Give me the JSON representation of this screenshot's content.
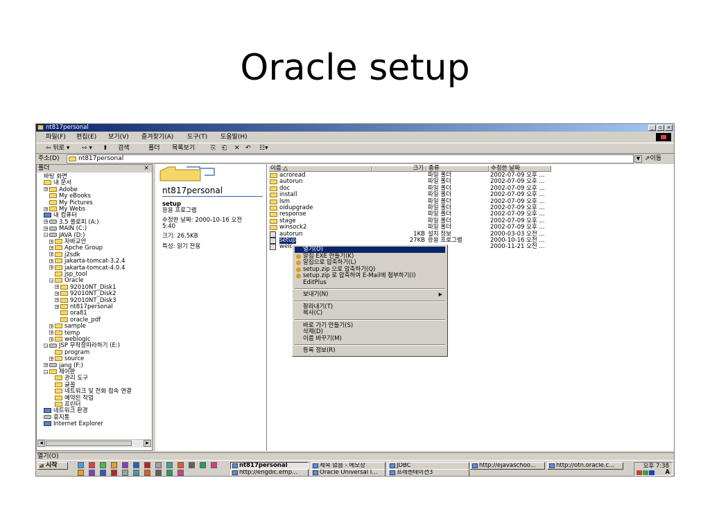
{
  "slide": {
    "title": "Oracle setup"
  },
  "window": {
    "title": "nt817personal",
    "min": "_",
    "max": "▫",
    "close": "×"
  },
  "menubar": [
    "파일(F)",
    "편집(E)",
    "보기(V)",
    "즐겨찾기(A)",
    "도구(T)",
    "도움말(H)"
  ],
  "toolbar": {
    "back": "⇦ 뒤로 ▾",
    "forward": "⇨ ▾",
    "up": "⬆",
    "search": "검색",
    "folders": "폴더",
    "history": "목록보기",
    "move": "⎘",
    "copy": "⎗",
    "delete": "✕",
    "undo": "↶",
    "views": "☷▾"
  },
  "address": {
    "label": "주소(D)",
    "value": "nt817personal",
    "dropdown": "▼",
    "go": "⇗이동"
  },
  "tree": {
    "header": "폴더",
    "close": "×",
    "items": [
      {
        "label": "바탕 화면",
        "lvl": 0,
        "ex": "",
        "icon": ""
      },
      {
        "label": "내 문서",
        "lvl": 0,
        "ex": "",
        "icon": "fd"
      },
      {
        "label": "Adobe",
        "lvl": 1,
        "ex": "+",
        "icon": "fd"
      },
      {
        "label": "My eBooks",
        "lvl": 1,
        "ex": "",
        "icon": "fd"
      },
      {
        "label": "My Pictures",
        "lvl": 1,
        "ex": "",
        "icon": "fd"
      },
      {
        "label": "My Webs",
        "lvl": 1,
        "ex": "+",
        "icon": "fd"
      },
      {
        "label": "내 컴퓨터",
        "lvl": 0,
        "ex": "",
        "icon": "pc"
      },
      {
        "label": "3.5 플로피 (A:)",
        "lvl": 1,
        "ex": "+",
        "icon": "dv"
      },
      {
        "label": "MAIN (C:)",
        "lvl": 1,
        "ex": "+",
        "icon": "dv"
      },
      {
        "label": "JAVA (D:)",
        "lvl": 1,
        "ex": "−",
        "icon": "dv"
      },
      {
        "label": "자바교안",
        "lvl": 2,
        "ex": "+",
        "icon": "fd"
      },
      {
        "label": "Apche Group",
        "lvl": 2,
        "ex": "+",
        "icon": "fd"
      },
      {
        "label": "j2sdk",
        "lvl": 2,
        "ex": "+",
        "icon": "fd"
      },
      {
        "label": "jakarta-tomcat-3.2.4",
        "lvl": 2,
        "ex": "+",
        "icon": "fd"
      },
      {
        "label": "jakarta-tomcat-4.0.4",
        "lvl": 2,
        "ex": "+",
        "icon": "fd"
      },
      {
        "label": "jsp_tool",
        "lvl": 2,
        "ex": "",
        "icon": "fd"
      },
      {
        "label": "Oracle",
        "lvl": 2,
        "ex": "−",
        "icon": "fd"
      },
      {
        "label": "92010NT_Disk1",
        "lvl": 3,
        "ex": "+",
        "icon": "fd"
      },
      {
        "label": "92010NT_Disk2",
        "lvl": 3,
        "ex": "+",
        "icon": "fd"
      },
      {
        "label": "92010NT_Disk3",
        "lvl": 3,
        "ex": "+",
        "icon": "fd"
      },
      {
        "label": "nt817personal",
        "lvl": 3,
        "ex": "+",
        "icon": "fd"
      },
      {
        "label": "ora81",
        "lvl": 3,
        "ex": "",
        "icon": "fd"
      },
      {
        "label": "oracle_pdf",
        "lvl": 3,
        "ex": "",
        "icon": "fd"
      },
      {
        "label": "sample",
        "lvl": 2,
        "ex": "+",
        "icon": "fd"
      },
      {
        "label": "temp",
        "lvl": 2,
        "ex": "+",
        "icon": "fd"
      },
      {
        "label": "weblogic",
        "lvl": 2,
        "ex": "+",
        "icon": "fd"
      },
      {
        "label": "JSP 무작정따라하기 (E:)",
        "lvl": 1,
        "ex": "−",
        "icon": "dv"
      },
      {
        "label": "program",
        "lvl": 2,
        "ex": "",
        "icon": "fd"
      },
      {
        "label": "source",
        "lvl": 2,
        "ex": "+",
        "icon": "fd"
      },
      {
        "label": "jang (F:)",
        "lvl": 1,
        "ex": "+",
        "icon": "dv"
      },
      {
        "label": "제어판",
        "lvl": 1,
        "ex": "−",
        "icon": "fd"
      },
      {
        "label": "관리 도구",
        "lvl": 2,
        "ex": "",
        "icon": "fd"
      },
      {
        "label": "글꼴",
        "lvl": 2,
        "ex": "",
        "icon": "fd"
      },
      {
        "label": "네트워크 및 전화 접속 연결",
        "lvl": 2,
        "ex": "",
        "icon": "fd"
      },
      {
        "label": "예약된 작업",
        "lvl": 2,
        "ex": "",
        "icon": "fd"
      },
      {
        "label": "프린터",
        "lvl": 2,
        "ex": "",
        "icon": "fd"
      },
      {
        "label": "네트워크 환경",
        "lvl": 0,
        "ex": "",
        "icon": "pc"
      },
      {
        "label": "휴지통",
        "lvl": 0,
        "ex": "",
        "icon": "dv"
      },
      {
        "label": "Internet Explorer",
        "lvl": 0,
        "ex": "",
        "icon": "pc"
      }
    ]
  },
  "info": {
    "folder_title": "nt817personal",
    "item_name": "setup",
    "item_type": "응용 프로그램",
    "modified_line1": "수정한 날짜: 2000-10-16 오전",
    "modified_line2": "5:40",
    "size": "크기: 26.5KB",
    "attributes": "특성: 읽기 전용"
  },
  "list": {
    "headers": {
      "name": "이름",
      "size": "크기",
      "type": "종류",
      "modified": "수정한 날짜"
    },
    "rows": [
      {
        "name": "acroread",
        "size": "",
        "type": "파일 폴더",
        "modified": "2002-07-09 오후 ...",
        "icon": "fd"
      },
      {
        "name": "autorun",
        "size": "",
        "type": "파일 폴더",
        "modified": "2002-07-09 오후 ...",
        "icon": "fd"
      },
      {
        "name": "doc",
        "size": "",
        "type": "파일 폴더",
        "modified": "2002-07-09 오후 ...",
        "icon": "fd"
      },
      {
        "name": "install",
        "size": "",
        "type": "파일 폴더",
        "modified": "2002-07-09 오후 ...",
        "icon": "fd"
      },
      {
        "name": "lsm",
        "size": "",
        "type": "파일 폴더",
        "modified": "2002-07-09 오후 ...",
        "icon": "fd"
      },
      {
        "name": "oidupgrade",
        "size": "",
        "type": "파일 폴더",
        "modified": "2002-07-09 오후 ...",
        "icon": "fd"
      },
      {
        "name": "response",
        "size": "",
        "type": "파일 폴더",
        "modified": "2002-07-09 오후 ...",
        "icon": "fd"
      },
      {
        "name": "stage",
        "size": "",
        "type": "파일 폴더",
        "modified": "2002-07-09 오후 ...",
        "icon": "fd"
      },
      {
        "name": "winsock2",
        "size": "",
        "type": "파일 폴더",
        "modified": "2002-07-09 오후 ...",
        "icon": "fd"
      },
      {
        "name": "autorun",
        "size": "1KB",
        "type": "설치 정보",
        "modified": "2000-03-03 오전 ...",
        "icon": "ic"
      },
      {
        "name": "setup",
        "size": "27KB",
        "type": "응용 프로그램",
        "modified": "2000-10-16 오전 ...",
        "icon": "ic",
        "selected": true
      },
      {
        "name": "welc",
        "size": "",
        "type": "",
        "modified": "2000-11-21 오전 ...",
        "icon": "ic"
      }
    ]
  },
  "context_menu": {
    "items": [
      {
        "label": "열기(O)",
        "highlight": true
      },
      {
        "label": "알집 EXE 만들기(K)",
        "icon": true
      },
      {
        "label": "알집으로 압축하기(L)",
        "icon": true
      },
      {
        "label": "setup.zip 으로 압축하기(Q)",
        "icon": true
      },
      {
        "label": "setup.zip 로 압축하여 E-Mail에 첨부하기(I)",
        "icon": true
      },
      {
        "label": "EditPlus"
      },
      {
        "sep": true
      },
      {
        "label": "보내기(N)",
        "arrow": "▶"
      },
      {
        "sep": true
      },
      {
        "label": "잘라내기(T)"
      },
      {
        "label": "복사(C)"
      },
      {
        "sep": true
      },
      {
        "label": "바로 가기 만들기(S)"
      },
      {
        "label": "삭제(D)"
      },
      {
        "label": "이름 바꾸기(M)"
      },
      {
        "sep": true
      },
      {
        "label": "등록 정보(R)"
      }
    ]
  },
  "statusbar": {
    "text": "열기(O)"
  },
  "taskbar": {
    "start": "시작",
    "buttons_row1": [
      {
        "label": "nt817personal",
        "active": true
      },
      {
        "label": "제목 없음 - 메모장"
      },
      {
        "label": "JDBC"
      },
      {
        "label": "http://ejavaschoo..."
      },
      {
        "label": "http://otn.oracle.c..."
      }
    ],
    "buttons_row2": [
      {
        "label": "http://engdic.emp..."
      },
      {
        "label": "Oracle Universal I..."
      },
      {
        "label": "프레젠테이션3"
      }
    ],
    "clock": "오후 7:38",
    "ime": "A"
  }
}
